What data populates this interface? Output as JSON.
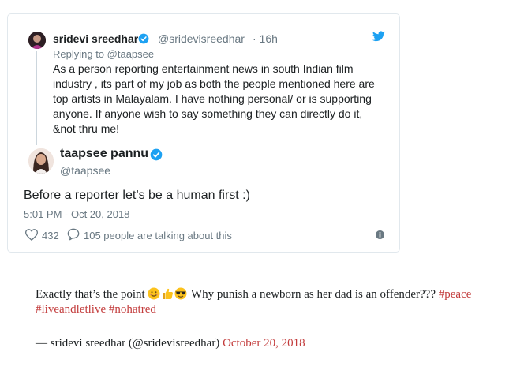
{
  "reply_tweet": {
    "author_name": "sridevi sreedhar",
    "handle": "@sridevisreedhar",
    "time_ago": "· 16h",
    "replying_to": "Replying to @taapsee",
    "text": "As a person reporting entertainment news in south Indian film industry , its part of my job  as both the people mentioned here are top artists in Malayalam. I have nothing personal/ or is supporting anyone. If anyone wish to say something they can directly do it, &not thru me!"
  },
  "main_tweet": {
    "author_name": "taapsee pannu",
    "handle": "@taapsee",
    "text": "Before a reporter let’s be a human first :)",
    "timestamp": "5:01 PM - Oct 20, 2018",
    "like_count": "432",
    "talking_text": "105 people are talking about this"
  },
  "embedded_quote": {
    "text_start": "Exactly that’s the point ",
    "text_mid": " Why punish a newborn as her dad is an offender??? ",
    "hashtag_peace": "#peace",
    "hashtag_live": "#liveandletlive",
    "hashtag_nohatred": "#nohatred",
    "attribution": "— sridevi sreedhar (@sridevisreedhar) ",
    "date": "October 20, 2018"
  },
  "colors": {
    "twitter_blue": "#1da1f2",
    "link_red": "#c33c3c",
    "muted_gray": "#697882"
  },
  "icons": [
    "twitter-bird-icon",
    "verified-icon",
    "heart-icon",
    "speech-bubble-icon",
    "info-icon",
    "smiling-emoji",
    "thumbs-up-emoji",
    "sunglasses-emoji"
  ]
}
